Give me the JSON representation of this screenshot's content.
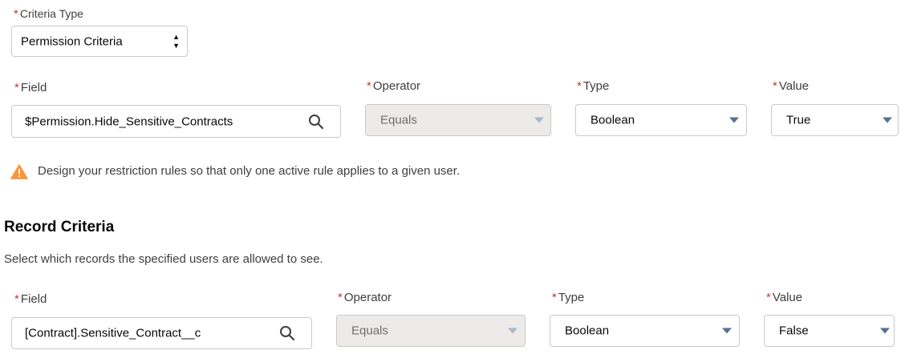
{
  "criteria_type": {
    "label": "Criteria Type",
    "value": "Permission Criteria"
  },
  "permission_row": {
    "field_label": "Field",
    "field_value": "$Permission.Hide_Sensitive_Contracts",
    "operator_label": "Operator",
    "operator_value": "Equals",
    "type_label": "Type",
    "type_value": "Boolean",
    "value_label": "Value",
    "value_value": "True"
  },
  "warning": {
    "icon": "warning-triangle-icon",
    "text": "Design your restriction rules so that only one active rule applies to a given user."
  },
  "record_criteria": {
    "heading": "Record Criteria",
    "description": "Select which records the specified users are allowed to see."
  },
  "record_row": {
    "field_label": "Field",
    "field_value": "[Contract].Sensitive_Contract__c",
    "operator_label": "Operator",
    "operator_value": "Equals",
    "type_label": "Type",
    "type_value": "Boolean",
    "value_label": "Value",
    "value_value": "False"
  },
  "colors": {
    "required": "#c23934",
    "warning": "#fe9339",
    "caret": "#5a6f8f",
    "border": "#c9c9c9",
    "disabled_bg": "#ecebea"
  }
}
